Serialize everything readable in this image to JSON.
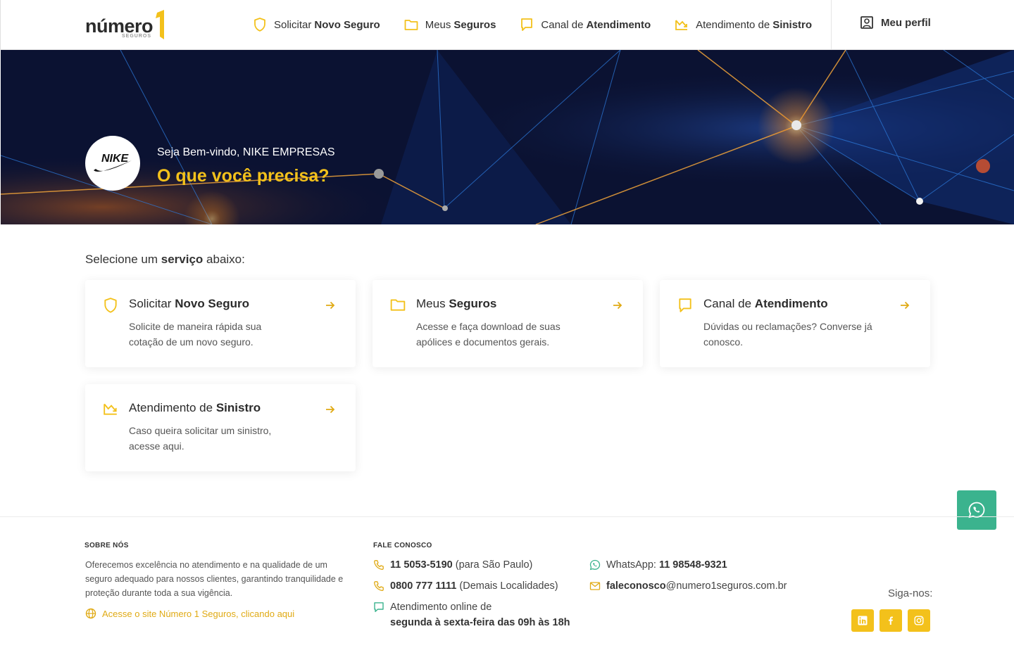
{
  "brand": {
    "logo_text": "número",
    "logo_sub": "SEGUROS",
    "accent": "#f3c11b"
  },
  "nav": {
    "items": [
      {
        "pre": "Solicitar",
        "bold": "Novo Seguro",
        "icon": "shield-icon"
      },
      {
        "pre": "Meus",
        "bold": "Seguros",
        "icon": "folder-icon"
      },
      {
        "pre": "Canal de",
        "bold": "Atendimento",
        "icon": "chat-icon"
      },
      {
        "pre": "Atendimento de",
        "bold": "Sinistro",
        "icon": "return-arrow-icon"
      }
    ],
    "profile": "Meu perfil"
  },
  "hero": {
    "avatar_text": "NIKE",
    "welcome": "Seja Bem-vindo, NIKE EMPRESAS",
    "question": "O que você precisa?"
  },
  "main": {
    "select_pre": "Selecione um",
    "select_bold": "serviço",
    "select_post": "abaixo:",
    "cards": [
      {
        "pre": "Solicitar",
        "bold": "Novo Seguro",
        "desc": "Solicite de maneira rápida sua cotação de um novo seguro.",
        "icon": "shield-icon"
      },
      {
        "pre": "Meus",
        "bold": "Seguros",
        "desc": "Acesse e faça download de suas apólices e documentos gerais.",
        "icon": "folder-icon"
      },
      {
        "pre": "Canal de",
        "bold": "Atendimento",
        "desc": "Dúvidas ou reclamações? Converse já conosco.",
        "icon": "chat-icon"
      },
      {
        "pre": "Atendimento de",
        "bold": "Sinistro",
        "desc": "Caso queira solicitar um sinistro, acesse aqui.",
        "icon": "return-arrow-icon"
      }
    ]
  },
  "footer": {
    "about_title": "SOBRE NÓS",
    "about_text": "Oferecemos excelência no atendimento e na qualidade de um seguro adequado para nossos clientes, garantindo tranquilidade e proteção durante toda a sua vigência.",
    "about_link": "Acesse o site Número 1 Seguros, clicando aqui",
    "contact_title": "FALE CONOSCO",
    "phone1_num": "11 5053-5190",
    "phone1_note": "(para São Paulo)",
    "phone2_num": "0800 777 1111",
    "phone2_note": "(Demais Localidades)",
    "online_line1": "Atendimento online de",
    "online_line2": "segunda à sexta-feira das 09h às 18h",
    "whatsapp_label": "WhatsApp:",
    "whatsapp_num": "11 98548-9321",
    "email_user": "faleconosco",
    "email_domain": "@numero1seguros.com.br",
    "follow": "Siga-nos:",
    "socials": [
      "linkedin-icon",
      "facebook-icon",
      "instagram-icon"
    ]
  }
}
